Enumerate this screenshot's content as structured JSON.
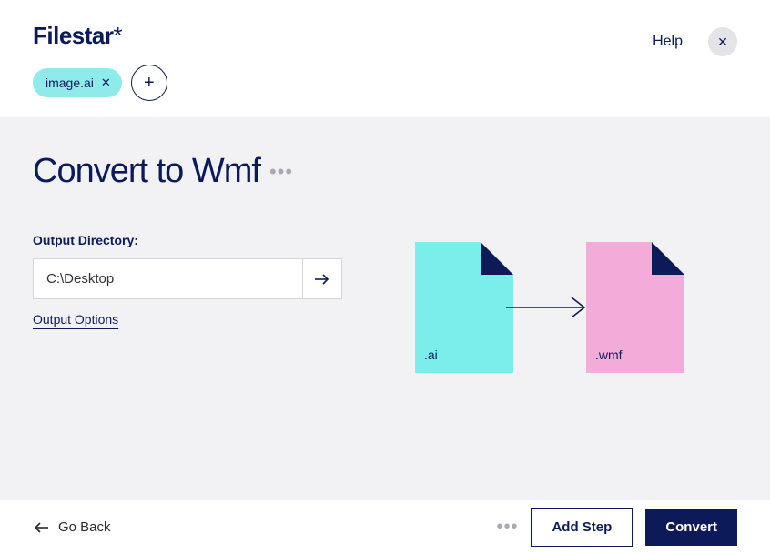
{
  "brand": {
    "name": "Filestar",
    "suffix": "*"
  },
  "header": {
    "file_chip": "image.ai",
    "help": "Help"
  },
  "main": {
    "title": "Convert to Wmf",
    "output_label": "Output Directory:",
    "output_value": "C:\\Desktop",
    "output_options": "Output Options"
  },
  "diagram": {
    "from_ext": ".ai",
    "to_ext": ".wmf"
  },
  "footer": {
    "back": "Go Back",
    "add_step": "Add Step",
    "convert": "Convert"
  }
}
